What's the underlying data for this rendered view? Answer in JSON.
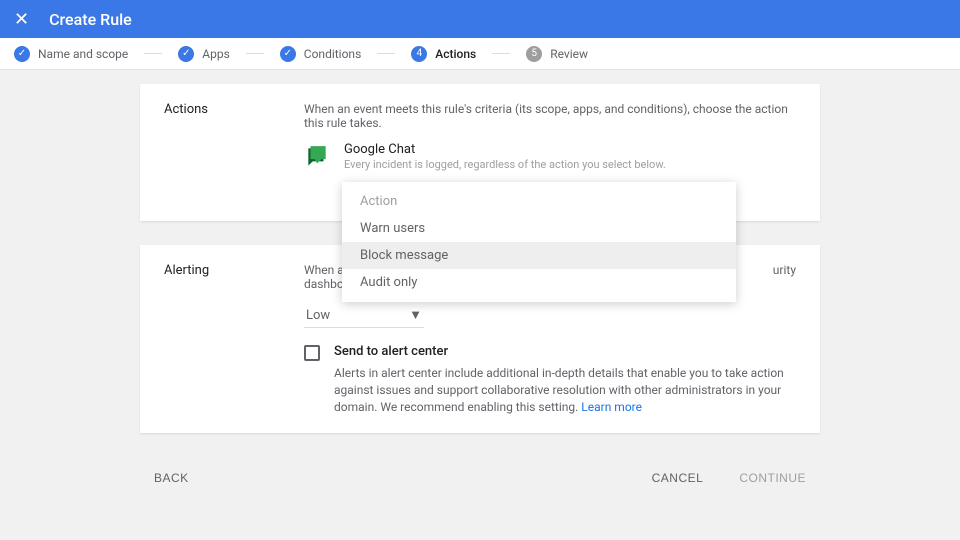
{
  "header": {
    "title": "Create Rule"
  },
  "steps": {
    "s1": "Name and scope",
    "s2": "Apps",
    "s3": "Conditions",
    "s4": "Actions",
    "s5": "Review",
    "num4": "4",
    "num5": "5"
  },
  "actions": {
    "section_label": "Actions",
    "description": "When an event meets this rule's criteria (its scope, apps, and conditions), choose the action this rule takes.",
    "app_name": "Google Chat",
    "app_sub": "Every incident is logged, regardless of the action you select below.",
    "select_value": "Action"
  },
  "dropdown": {
    "opt0": "Action",
    "opt1": "Warn users",
    "opt2": "Block message",
    "opt3": "Audit only"
  },
  "alerting": {
    "section_label": "Alerting",
    "description_visible": "When an e",
    "description_visible2": "dashboard",
    "description_right": "urity",
    "severity": "Low",
    "checkbox_label": "Send to alert center",
    "checkbox_desc": "Alerts in alert center include additional in-depth details that enable you to take action against issues and support collaborative resolution with other administrators in your domain. We recommend enabling this setting.",
    "learn_more": "Learn more"
  },
  "footer": {
    "back": "BACK",
    "cancel": "CANCEL",
    "continue": "CONTINUE"
  }
}
